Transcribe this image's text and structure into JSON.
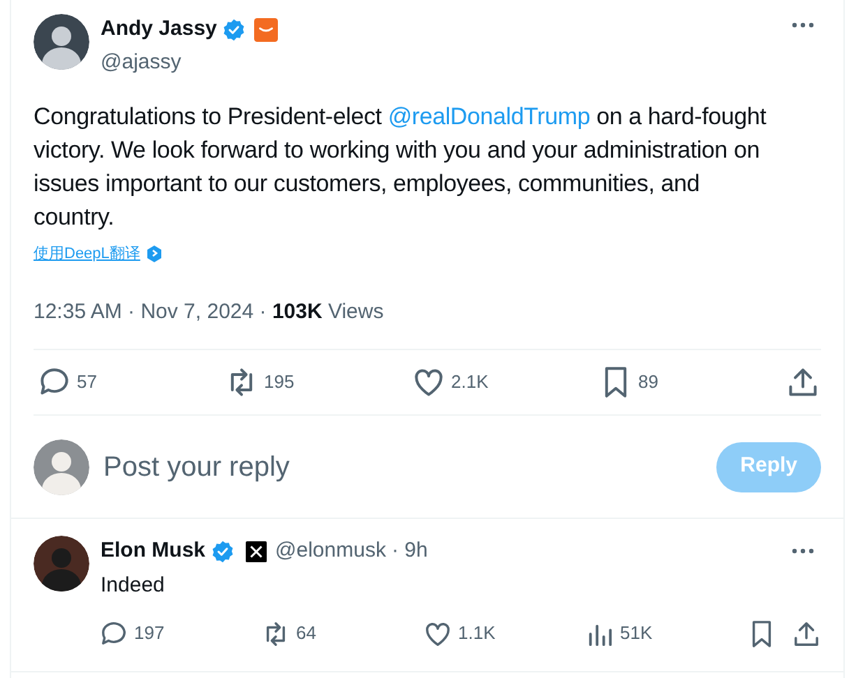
{
  "post": {
    "author": {
      "name": "Andy Jassy",
      "handle": "@ajassy",
      "verified": true,
      "affiliate_badge": true
    },
    "text": [
      {
        "kind": "text",
        "text": "Congratulations to President-elect "
      },
      {
        "kind": "mention",
        "text": "@realDonaldTrump"
      },
      {
        "kind": "text",
        "text": " on a hard-fought victory. We look forward to working with you and your administration on issues important to our customers, employees, communities, and country."
      }
    ],
    "translate_link": "使用DeepL翻译",
    "timestamp": "12:35 AM · Nov 7, 2024 · ",
    "views": "**103K** Views",
    "actions": [
      {
        "kind": "reply",
        "count": "57"
      },
      {
        "kind": "repost",
        "count": "195"
      },
      {
        "kind": "like",
        "count": "2.1K"
      },
      {
        "kind": "bookmark",
        "count": "89"
      },
      {
        "kind": "share"
      }
    ]
  },
  "composer": {
    "placeholder": "Post your reply",
    "button": "Reply",
    "disabled": true
  },
  "replies": [
    {
      "author": {
        "name": "Elon Musk",
        "handle": "@elonmusk",
        "verified": true,
        "affiliate_badge": true
      },
      "time": "· 9h",
      "text": "Indeed",
      "actions": [
        {
          "kind": "reply",
          "count": "197"
        },
        {
          "kind": "repost",
          "count": "64"
        },
        {
          "kind": "like",
          "count": "1.1K"
        },
        {
          "kind": "views",
          "count": "51K"
        },
        {
          "kind": "bookmark"
        },
        {
          "kind": "share"
        }
      ]
    }
  ]
}
